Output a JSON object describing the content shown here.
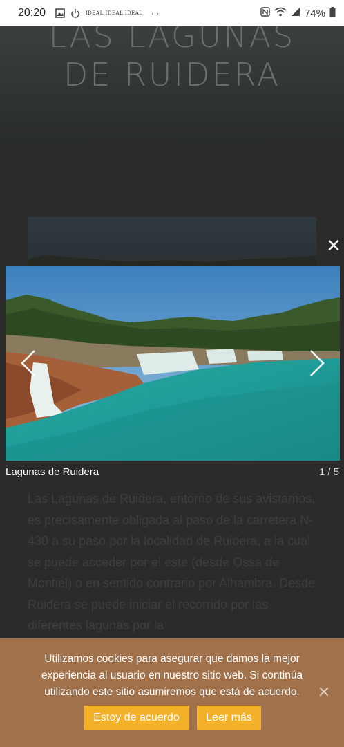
{
  "status_bar": {
    "time": "20:20",
    "ideal_text": "IDEAL IDEAL IDEAL",
    "dots": "···",
    "battery": "74%",
    "icons": [
      "gallery-icon",
      "power-icon",
      "nfc-icon",
      "wifi-icon",
      "signal-icon",
      "battery-icon"
    ]
  },
  "hero": {
    "title_line1": "LAS LAGUNAS",
    "title_line2": "DE RUIDERA"
  },
  "page_text": "Las Lagunas de Ruidera, entorno de sus avistamos, es precisamente obligada al paso de la carretera N-430 a su paso por la localidad de Ruidera, a la cual se puede acceder por el este (desde Ossa de Montiel) o en sentido contrario por Alhambra. Desde Ruidera se puede iniciar el recorrido por las diferentes lagunas por la",
  "lightbox": {
    "caption": "Lagunas de Ruidera",
    "counter": "1 / 5",
    "close_glyph": "✕"
  },
  "cookie": {
    "text": "Utilizamos cookies para asegurar que damos la mejor experiencia al usuario en nuestro sitio web. Si continúa utilizando este sitio asumiremos que está de acuerdo.",
    "agree_label": "Estoy de acuerdo",
    "more_label": "Leer más",
    "close_glyph": "✕"
  },
  "colors": {
    "cookie_bg": "#a0714b",
    "button_bg": "#f3b12a",
    "overlay_bg": "#2b2b2b"
  }
}
